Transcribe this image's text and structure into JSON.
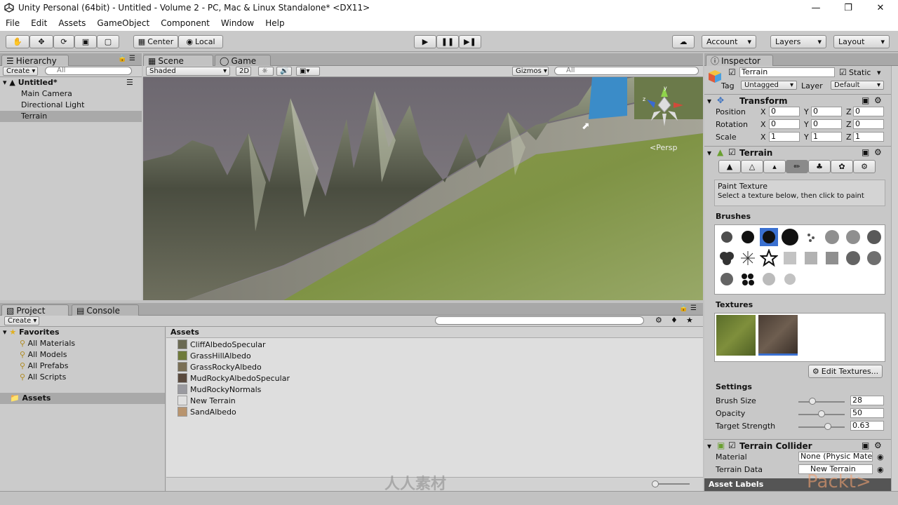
{
  "titlebar": {
    "title": "Unity Personal (64bit) - Untitled - Volume 2 - PC, Mac & Linux Standalone* <DX11>"
  },
  "menu": [
    "File",
    "Edit",
    "Assets",
    "GameObject",
    "Component",
    "Window",
    "Help"
  ],
  "toolbar": {
    "center": "Center",
    "local": "Local",
    "account": "Account",
    "layers": "Layers",
    "layout": "Layout"
  },
  "hierarchy": {
    "tab": "Hierarchy",
    "create": "Create",
    "search_placeholder": "All",
    "scene": "Untitled*",
    "items": [
      "Main Camera",
      "Directional Light",
      "Terrain"
    ]
  },
  "scene": {
    "tab_scene": "Scene",
    "tab_game": "Game",
    "shading": "Shaded",
    "mode2d": "2D",
    "gizmos": "Gizmos",
    "search_placeholder": "All",
    "persp": "Persp",
    "gizmo_y": "y",
    "gizmo_z": "z"
  },
  "project": {
    "tab_project": "Project",
    "tab_console": "Console",
    "create": "Create",
    "favorites": "Favorites",
    "fav_items": [
      "All Materials",
      "All Models",
      "All Prefabs",
      "All Scripts"
    ],
    "assets_folder": "Assets",
    "assets_header": "Assets",
    "assets": [
      {
        "name": "CliffAlbedoSpecular",
        "color": "#6b6a52"
      },
      {
        "name": "GrassHillAlbedo",
        "color": "#6f7a3a"
      },
      {
        "name": "GrassRockyAlbedo",
        "color": "#7a6f55"
      },
      {
        "name": "MudRockyAlbedoSpecular",
        "color": "#5a4a3e"
      },
      {
        "name": "MudRockyNormals",
        "color": "#9a9aa0"
      },
      {
        "name": "New Terrain",
        "color": "#e0e0e0"
      },
      {
        "name": "SandAlbedo",
        "color": "#b8946e"
      }
    ]
  },
  "inspector": {
    "tab": "Inspector",
    "object_name": "Terrain",
    "static": "Static",
    "tag_label": "Tag",
    "tag_value": "Untagged",
    "layer_label": "Layer",
    "layer_value": "Default",
    "transform": {
      "title": "Transform",
      "position": "Position",
      "rotation": "Rotation",
      "scale": "Scale",
      "x": "X",
      "y": "Y",
      "z": "Z",
      "pos": [
        "0",
        "0",
        "0"
      ],
      "rot": [
        "0",
        "0",
        "0"
      ],
      "scl": [
        "1",
        "1",
        "1"
      ]
    },
    "terrain": {
      "title": "Terrain",
      "paint_title": "Paint Texture",
      "paint_hint": "Select a texture below, then click to paint",
      "brushes": "Brushes",
      "textures": "Textures",
      "edit_textures": "Edit Textures...",
      "settings": "Settings",
      "brush_size_label": "Brush Size",
      "brush_size": "28",
      "brush_size_frac": 0.3,
      "opacity_label": "Opacity",
      "opacity": "50",
      "opacity_frac": 0.5,
      "strength_label": "Target Strength",
      "strength": "0.63",
      "strength_frac": 0.63
    },
    "collider": {
      "title": "Terrain Collider",
      "material_label": "Material",
      "material_value": "None (Physic Mate",
      "data_label": "Terrain Data",
      "data_value": "New Terrain"
    },
    "asset_labels": "Asset Labels"
  },
  "watermark": {
    "center": "人人素材",
    "right": "Packt>"
  }
}
